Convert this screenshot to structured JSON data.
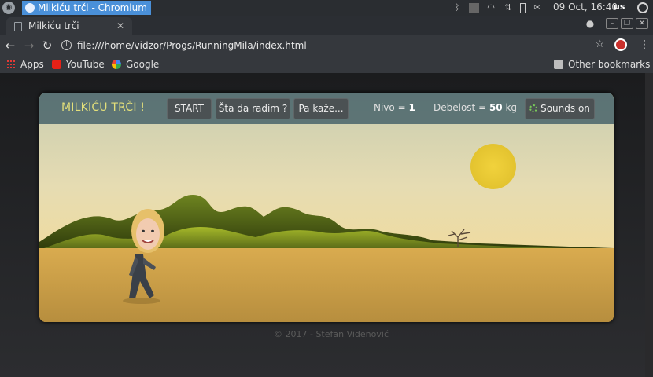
{
  "taskbar": {
    "window_title": "Milkiću trči - Chromium",
    "clock": "09 Oct, 16:40",
    "keyboard_layout": "us",
    "tray_icons": [
      "bluetooth-icon",
      "tray-square-icon",
      "wifi-icon",
      "ethernet-icon",
      "battery-icon",
      "mail-icon"
    ]
  },
  "browser": {
    "tab_title": "Milkiću trči",
    "url": "file:///home/vidzor/Progs/RunningMila/index.html",
    "bookmarks": [
      {
        "label": "Apps",
        "icon": "apps-icon"
      },
      {
        "label": "YouTube",
        "icon": "youtube-icon"
      },
      {
        "label": "Google",
        "icon": "google-icon"
      }
    ],
    "other_bookmarks": "Other bookmarks"
  },
  "game": {
    "title": "MILKIĆU TRČI !",
    "buttons": {
      "start": "START",
      "what_to_do": "Šta da radim ?",
      "says": "Pa kaže...",
      "sounds": "Sounds on"
    },
    "level_label": "Nivo = ",
    "level_value": "1",
    "weight_label": "Debelost = ",
    "weight_value": "50",
    "weight_unit": " kg",
    "colors": {
      "title": "#e3df7a",
      "sun": "#e8c93a",
      "hills": "#8aa21c",
      "ground": "#c9a14a"
    }
  },
  "footer": "© 2017 - Stefan Videnović"
}
